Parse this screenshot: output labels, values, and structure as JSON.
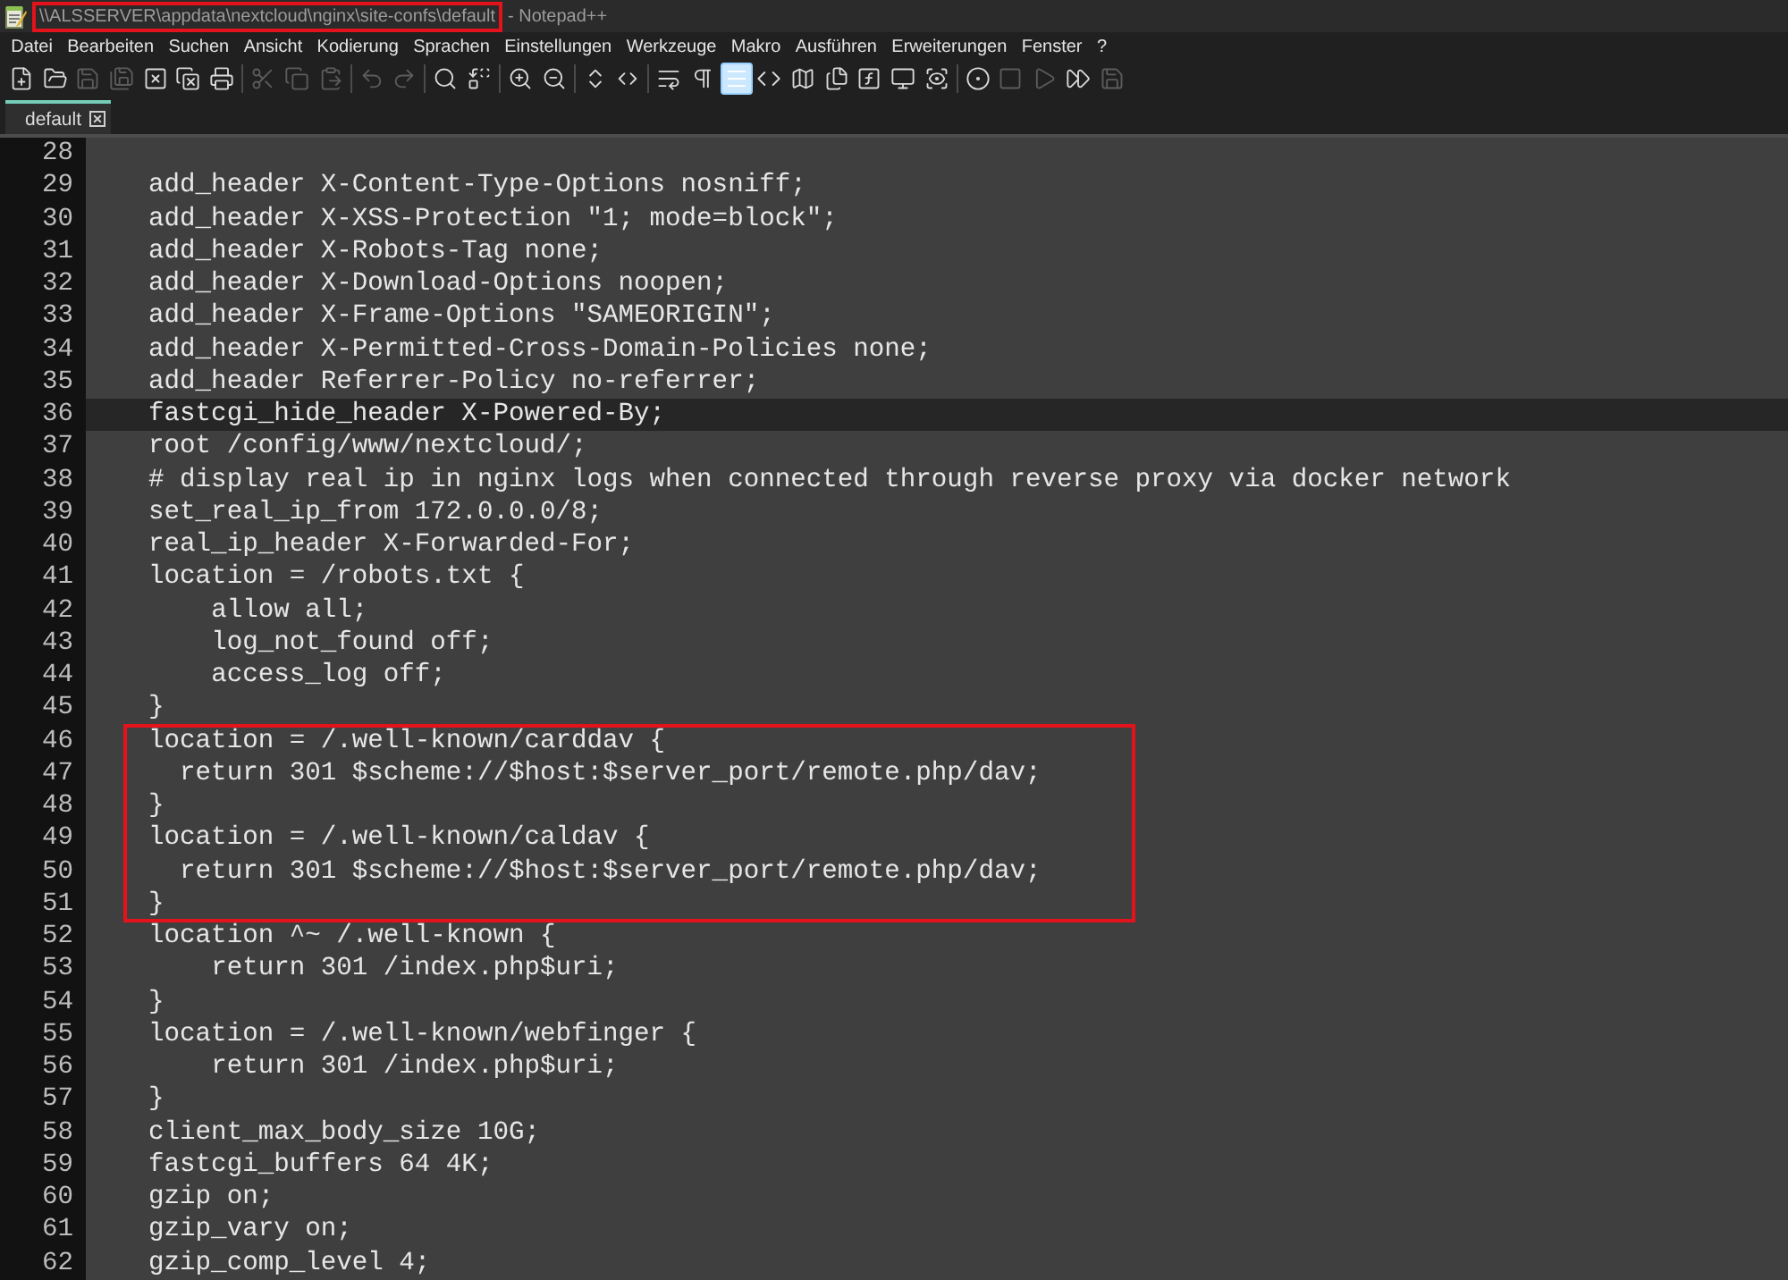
{
  "window": {
    "title": {
      "path": "\\\\ALSSERVER\\appdata\\nextcloud\\nginx\\site-confs\\default",
      "app": "- Notepad++",
      "marked": true
    }
  },
  "menu": [
    "Datei",
    "Bearbeiten",
    "Suchen",
    "Ansicht",
    "Kodierung",
    "Sprachen",
    "Einstellungen",
    "Werkzeuge",
    "Makro",
    "Ausführen",
    "Erweiterungen",
    "Fenster",
    "?"
  ],
  "toolbar": [
    [
      {
        "kind": "new",
        "disabled": false,
        "on": false
      },
      {
        "kind": "open",
        "disabled": false,
        "on": false
      },
      {
        "kind": "save",
        "disabled": true,
        "on": false
      },
      {
        "kind": "save_all",
        "disabled": true,
        "on": false
      },
      {
        "kind": "close",
        "disabled": false,
        "on": false
      },
      {
        "kind": "close_all",
        "disabled": false,
        "on": false
      },
      {
        "kind": "print",
        "disabled": false,
        "on": false
      }
    ],
    [
      {
        "kind": "cut",
        "disabled": true,
        "on": false
      },
      {
        "kind": "copy",
        "disabled": true,
        "on": false
      },
      {
        "kind": "paste",
        "disabled": true,
        "on": false
      }
    ],
    [
      {
        "kind": "undo",
        "disabled": true,
        "on": false
      },
      {
        "kind": "redo",
        "disabled": true,
        "on": false
      }
    ],
    [
      {
        "kind": "find",
        "disabled": false,
        "on": false
      },
      {
        "kind": "replace",
        "disabled": false,
        "on": false
      }
    ],
    [
      {
        "kind": "zoom_in",
        "disabled": false,
        "on": false
      },
      {
        "kind": "zoom_out",
        "disabled": false,
        "on": false
      }
    ],
    [
      {
        "kind": "sync_vertical",
        "disabled": false,
        "on": false
      },
      {
        "kind": "sync_horizontal",
        "disabled": false,
        "on": false
      }
    ],
    [
      {
        "kind": "wrap",
        "disabled": false,
        "on": false
      },
      {
        "kind": "all_chars",
        "disabled": false,
        "on": false
      },
      {
        "kind": "indent_guide",
        "disabled": false,
        "on": true
      },
      {
        "kind": "language",
        "disabled": false,
        "on": false
      },
      {
        "kind": "doc_map",
        "disabled": false,
        "on": false
      },
      {
        "kind": "doc_list",
        "disabled": false,
        "on": false
      },
      {
        "kind": "function_list",
        "disabled": false,
        "on": false
      },
      {
        "kind": "workspace",
        "disabled": false,
        "on": false
      },
      {
        "kind": "monitoring",
        "disabled": false,
        "on": false
      }
    ],
    [
      {
        "kind": "record",
        "disabled": false,
        "on": false
      },
      {
        "kind": "stop",
        "disabled": true,
        "on": false
      },
      {
        "kind": "play",
        "disabled": true,
        "on": false
      },
      {
        "kind": "play_multiple",
        "disabled": false,
        "on": false
      },
      {
        "kind": "save_macro",
        "disabled": true,
        "on": false
      }
    ]
  ],
  "tabs": [
    {
      "label": "default",
      "selected": true
    }
  ],
  "editor": {
    "blocks": [
      {
        "marked": false,
        "lines": [
          {
            "number": "28",
            "current": false
          },
          {
            "number": "29",
            "code": "    add_header X-Content-Type-Options nosniff;",
            "current": false
          },
          {
            "number": "30",
            "code": "    add_header X-XSS-Protection \"1; mode=block\";",
            "current": false
          },
          {
            "number": "31",
            "code": "    add_header X-Robots-Tag none;",
            "current": false
          },
          {
            "number": "32",
            "code": "    add_header X-Download-Options noopen;",
            "current": false
          },
          {
            "number": "33",
            "code": "    add_header X-Frame-Options \"SAMEORIGIN\";",
            "current": false
          },
          {
            "number": "34",
            "code": "    add_header X-Permitted-Cross-Domain-Policies none;",
            "current": false
          },
          {
            "number": "35",
            "code": "    add_header Referrer-Policy no-referrer;",
            "current": false
          },
          {
            "number": "36",
            "code": "    fastcgi_hide_header X-Powered-By;",
            "current": true
          },
          {
            "number": "37",
            "code": "    root /config/www/nextcloud/;",
            "current": false
          },
          {
            "number": "38",
            "code": "    # display real ip in nginx logs when connected through reverse proxy via docker network",
            "current": false
          },
          {
            "number": "39",
            "code": "    set_real_ip_from 172.0.0.0/8;",
            "current": false
          },
          {
            "number": "40",
            "code": "    real_ip_header X-Forwarded-For;",
            "current": false
          },
          {
            "number": "41",
            "code": "    location = /robots.txt {",
            "current": false
          },
          {
            "number": "42",
            "code": "        allow all;",
            "current": false
          },
          {
            "number": "43",
            "code": "        log_not_found off;",
            "current": false
          },
          {
            "number": "44",
            "code": "        access_log off;",
            "current": false
          },
          {
            "number": "45",
            "code": "    }",
            "current": false
          }
        ]
      },
      {
        "marked": true,
        "lines": [
          {
            "number": "46",
            "code": "    location = /.well-known/carddav {",
            "current": false
          },
          {
            "number": "47",
            "code": "      return 301 $scheme://$host:$server_port/remote.php/dav;",
            "current": false
          },
          {
            "number": "48",
            "code": "    }",
            "current": false
          },
          {
            "number": "49",
            "code": "    location = /.well-known/caldav {",
            "current": false
          },
          {
            "number": "50",
            "code": "      return 301 $scheme://$host:$server_port/remote.php/dav;",
            "current": false
          },
          {
            "number": "51",
            "code": "    }",
            "current": false
          }
        ]
      },
      {
        "marked": false,
        "lines": [
          {
            "number": "52",
            "code": "    location ^~ /.well-known {",
            "current": false
          },
          {
            "number": "53",
            "code": "        return 301 /index.php$uri;",
            "current": false
          },
          {
            "number": "54",
            "code": "    }",
            "current": false
          },
          {
            "number": "55",
            "code": "    location = /.well-known/webfinger {",
            "current": false
          },
          {
            "number": "56",
            "code": "        return 301 /index.php$uri;",
            "current": false
          },
          {
            "number": "57",
            "code": "    }",
            "current": false
          },
          {
            "number": "58",
            "code": "    client_max_body_size 10G;",
            "current": false
          },
          {
            "number": "59",
            "code": "    fastcgi_buffers 64 4K;",
            "current": false
          },
          {
            "number": "60",
            "code": "    gzip on;",
            "current": false
          },
          {
            "number": "61",
            "code": "    gzip_vary on;",
            "current": false
          },
          {
            "number": "62",
            "code": "    gzip_comp_level 4;",
            "current": false
          }
        ]
      }
    ]
  }
}
